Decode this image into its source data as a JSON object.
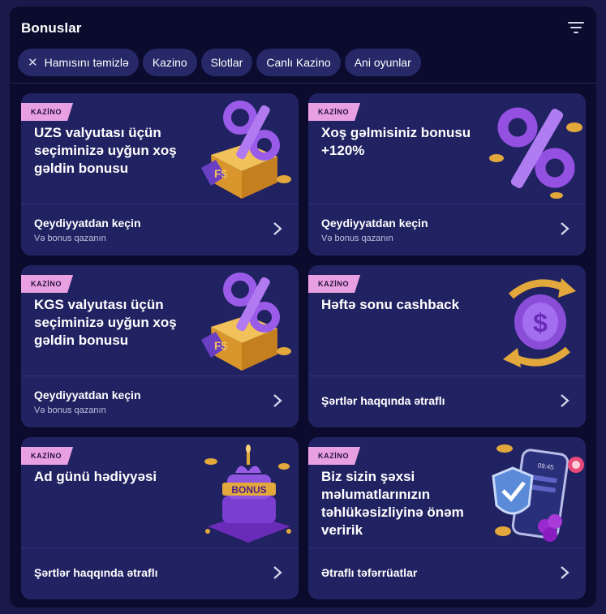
{
  "header": {
    "title": "Bonuslar",
    "filter_icon": "filter-lines-icon"
  },
  "chips": [
    "Hamısını təmizlə",
    "Kazino",
    "Slotlar",
    "Canlı Kazino",
    "Ani oyunlar"
  ],
  "colors": {
    "badge": "#e9a0e2",
    "card": "#212262",
    "panel": "#0b0b2e",
    "accent_purple": "#8a4dd8",
    "gold": "#e2a83b"
  },
  "cards": [
    {
      "badge": "KAZİNO",
      "title": "UZS valyutası üçün seçiminizə uyğun xoş gəldin bonusu",
      "action": "Qeydiyyatdan keçin",
      "sub": "Və bonus qazanın",
      "art": "percent-box-icon"
    },
    {
      "badge": "KAZİNO",
      "title": "Xoş gəlmisiniz bonusu +120%",
      "action": "Qeydiyyatdan keçin",
      "sub": "Və bonus qazanın",
      "art": "percent-sign-icon"
    },
    {
      "badge": "KAZİNO",
      "title": "KGS valyutası üçün seçiminizə uyğun xoş gəldin bonusu",
      "action": "Qeydiyyatdan keçin",
      "sub": "Və bonus qazanın",
      "art": "percent-box-icon"
    },
    {
      "badge": "KAZİNO",
      "title": "Həftə sonu cashback",
      "action": "Şərtlər haqqında ətraflı",
      "sub": "",
      "art": "cashback-coin-icon"
    },
    {
      "badge": "KAZİNO",
      "title": "Ad günü hədiyyəsi",
      "action": "Şərtlər haqqında ətraflı",
      "sub": "",
      "art": "bonus-cake-icon",
      "art_text": "BONUS"
    },
    {
      "badge": "KAZİNO",
      "title": "Biz sizin şəxsi məlumatlarınızın təhlükəsizliyinə önəm veririk",
      "action": "Ətraflı təfərrüatlar",
      "sub": "",
      "art": "security-phone-icon",
      "art_text": "09:45"
    }
  ]
}
